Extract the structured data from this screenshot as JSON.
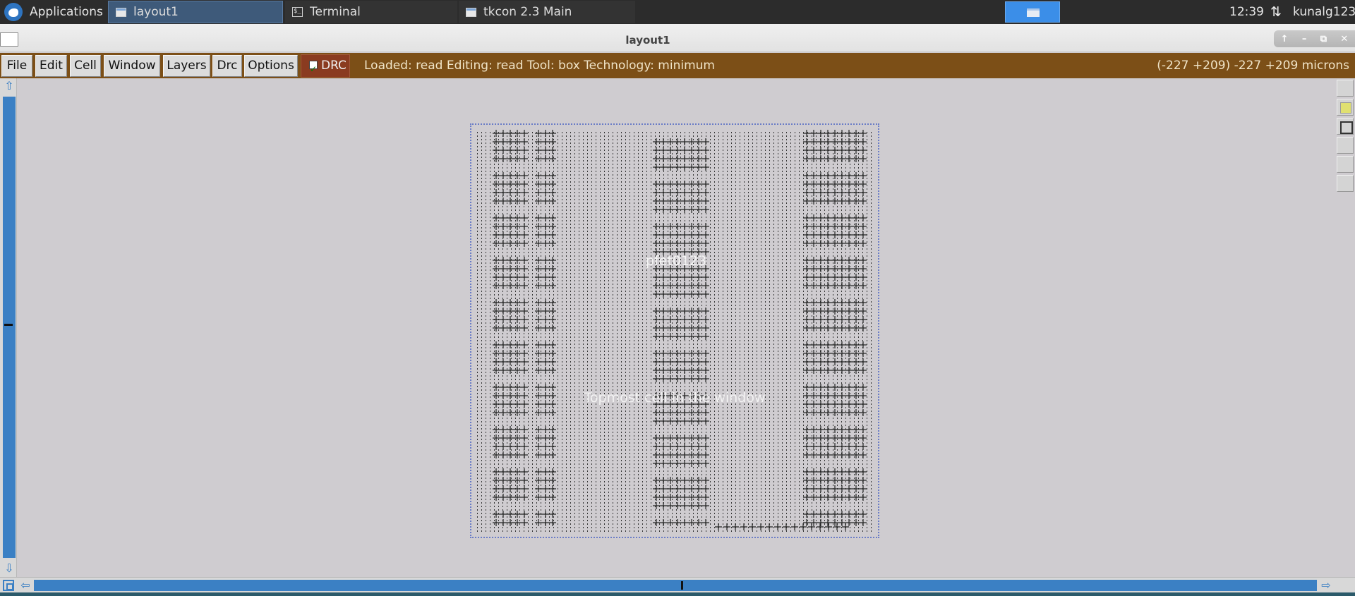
{
  "taskbar": {
    "applications_label": "Applications",
    "tasks": [
      {
        "label": "layout1",
        "active": true
      },
      {
        "label": "Terminal",
        "active": false
      },
      {
        "label": "tkcon 2.3 Main",
        "active": false
      }
    ],
    "clock": "12:39",
    "user": "kunalg123"
  },
  "window": {
    "title": "layout1"
  },
  "menubar": {
    "items": [
      "File",
      "Edit",
      "Cell",
      "Window",
      "Layers",
      "Drc",
      "Options"
    ],
    "drc_toggle": {
      "label": "DRC",
      "checked": true
    },
    "status": "Loaded: read Editing: read Tool: box  Technology: minimum",
    "coordinates": "(-227 +209) -227 +209 microns"
  },
  "canvas": {
    "cell_name": "pfet0123",
    "cell_description": "Topmost cell in the window"
  },
  "colors": {
    "menubar_bg": "#7c4f17",
    "drc_bg": "#8a3b20",
    "scrollbar_accent": "#3b80c4",
    "canvas_bg": "#cfccd0",
    "cell_border": "#6a7cc6"
  }
}
